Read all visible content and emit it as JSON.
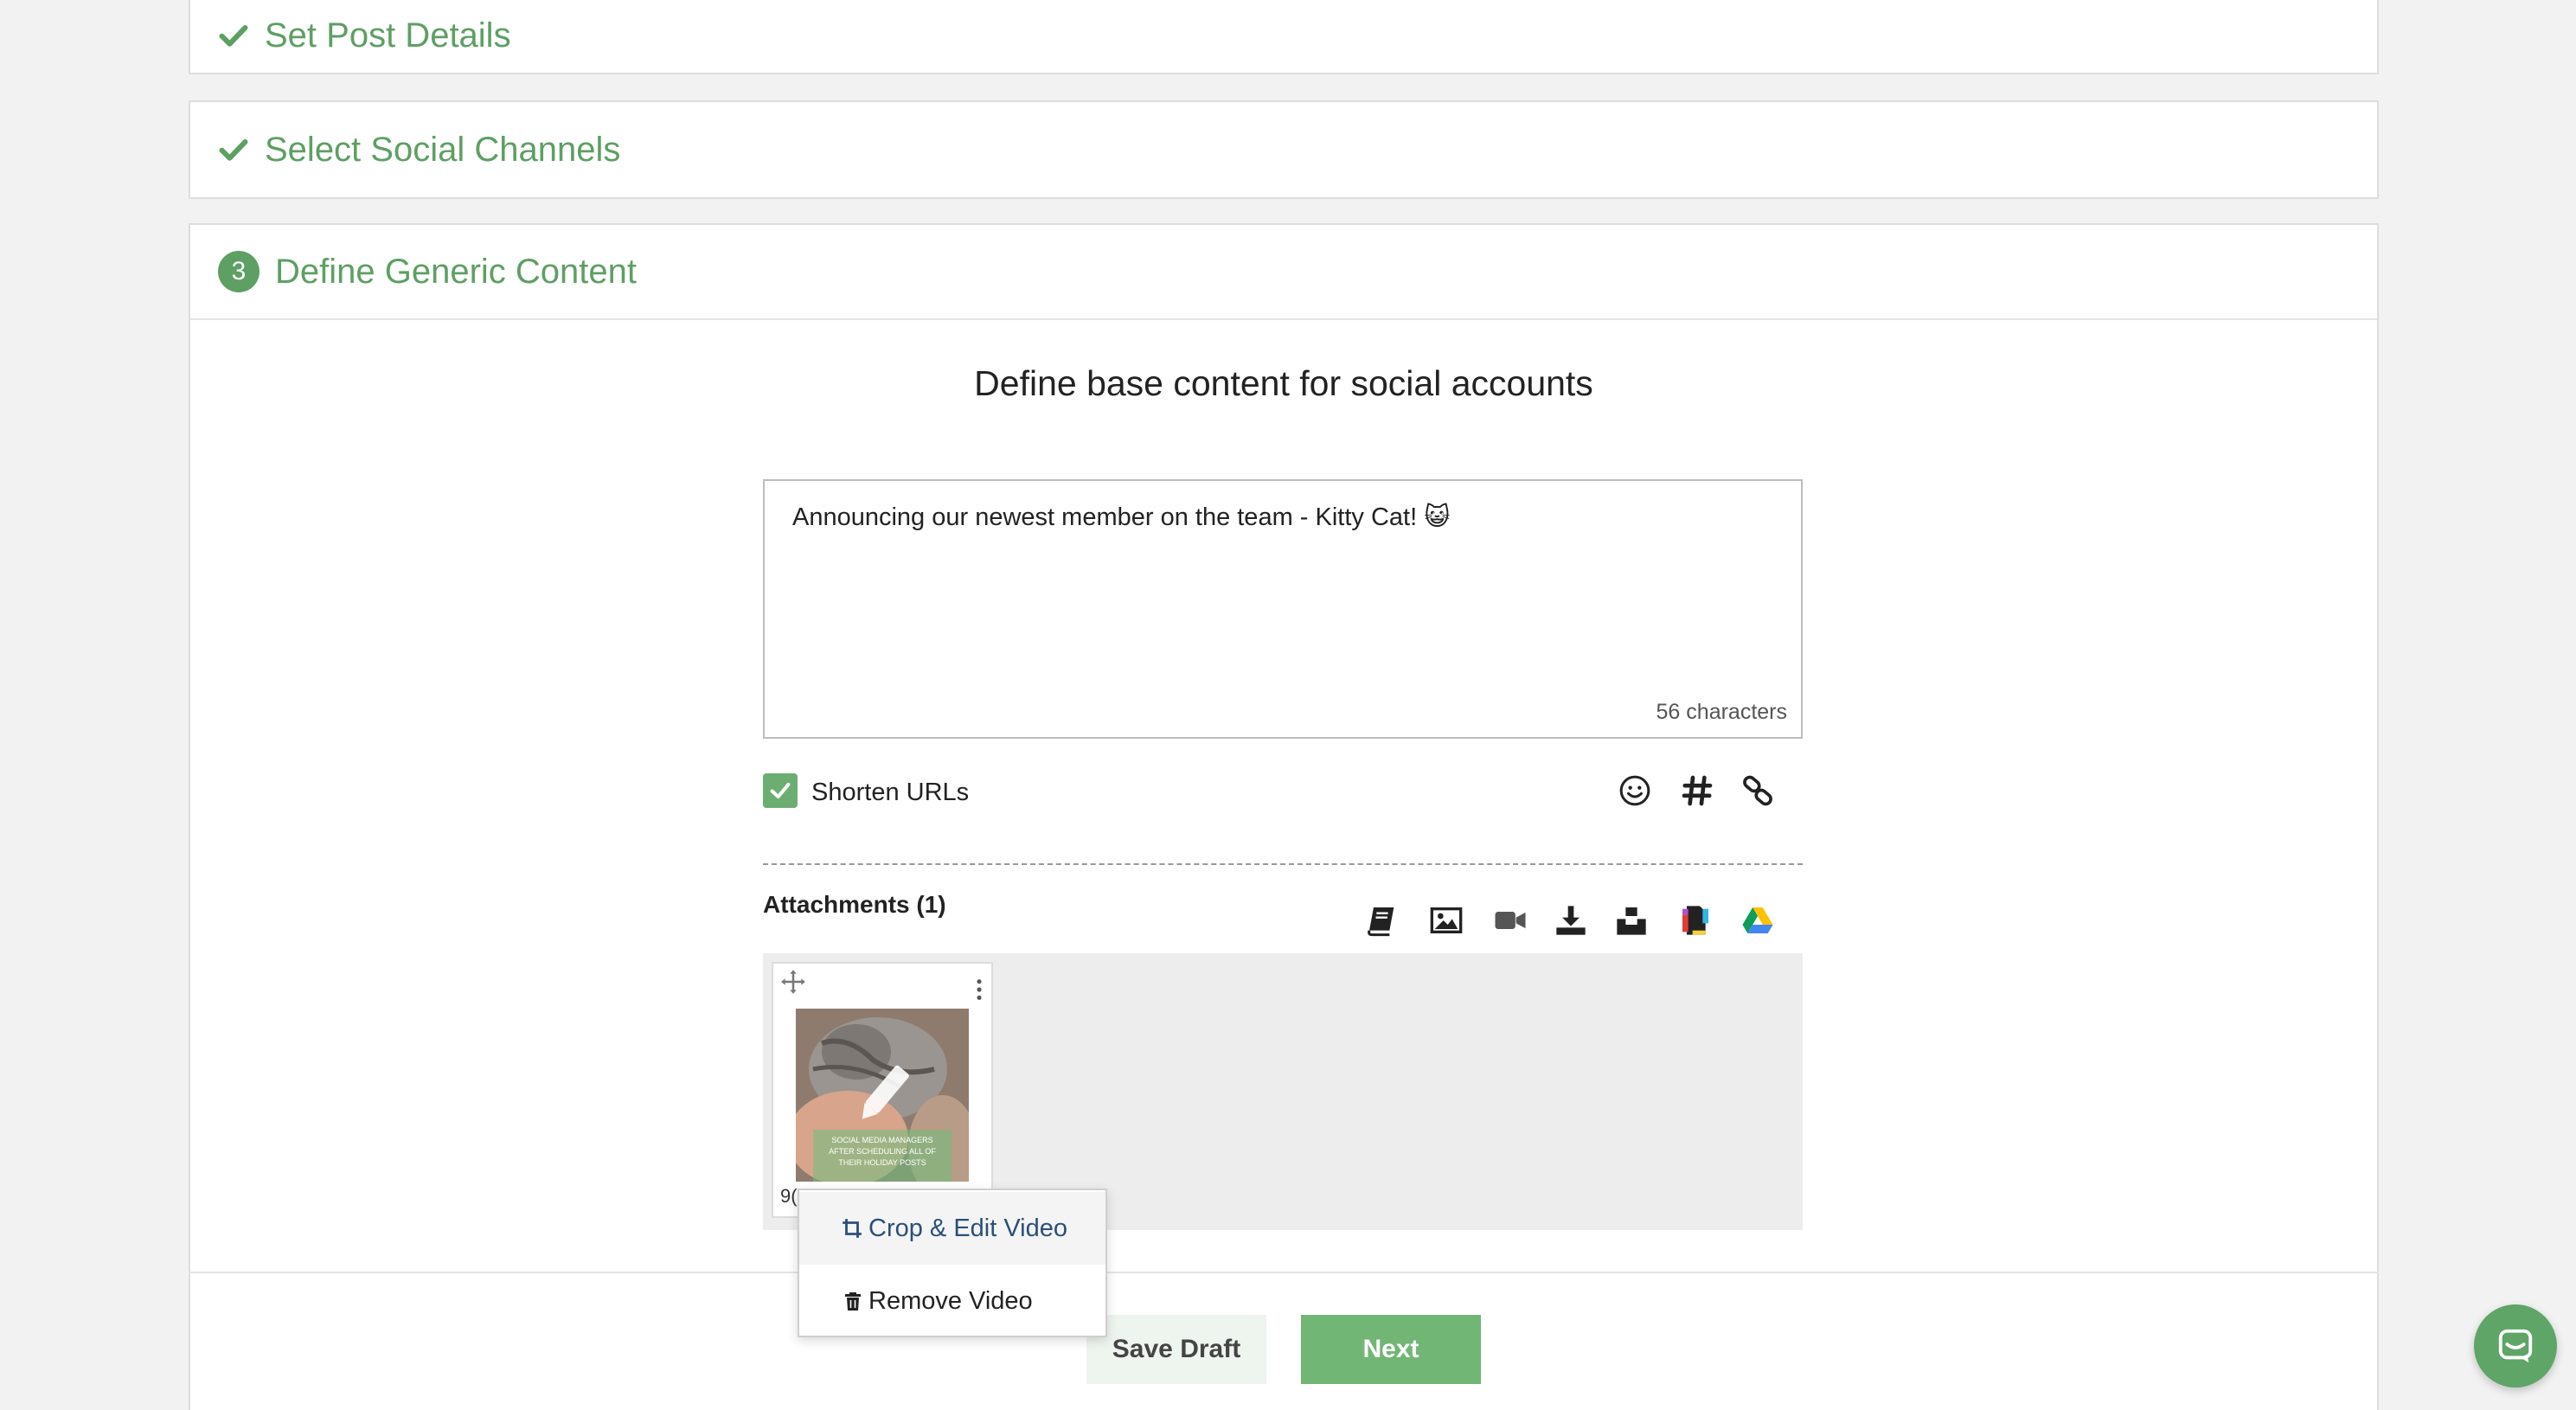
{
  "steps": {
    "step1": {
      "label": "Set Post Details",
      "status_icon": "check-icon"
    },
    "step2": {
      "label": "Select Social Channels",
      "status_icon": "check-icon"
    },
    "step3": {
      "number": "3",
      "label": "Define Generic Content"
    }
  },
  "content": {
    "section_title": "Define base content for social accounts",
    "composer_text": "Announcing our newest member on the team - Kitty Cat! 😺",
    "char_count": "56 characters",
    "shorten_urls_label": "Shorten URLs",
    "shorten_urls_checked": true,
    "tools": [
      "emoji-icon",
      "hashtag-icon",
      "link-icon"
    ]
  },
  "attachments": {
    "title": "Attachments (1)",
    "source_icons": [
      "library-icon",
      "image-icon",
      "video-icon",
      "download-icon",
      "unsplash-icon",
      "canva-icon",
      "google-drive-icon"
    ],
    "items": [
      {
        "caption": "9(",
        "thumb_text": "SOCIAL MEDIA MANAGERS AFTER SCHEDULING ALL OF THEIR HOLIDAY POSTS"
      }
    ]
  },
  "context_menu": {
    "items": [
      {
        "label": "Crop & Edit Video",
        "icon": "crop-icon"
      },
      {
        "label": "Remove Video",
        "icon": "trash-icon"
      }
    ]
  },
  "footer": {
    "save_draft_label": "Save Draft",
    "next_label": "Next"
  },
  "colors": {
    "accent": "#5e9f63",
    "button_primary": "#72b676",
    "button_secondary_bg": "#eef4ee",
    "menu_hover_text": "#2a4f7a"
  }
}
